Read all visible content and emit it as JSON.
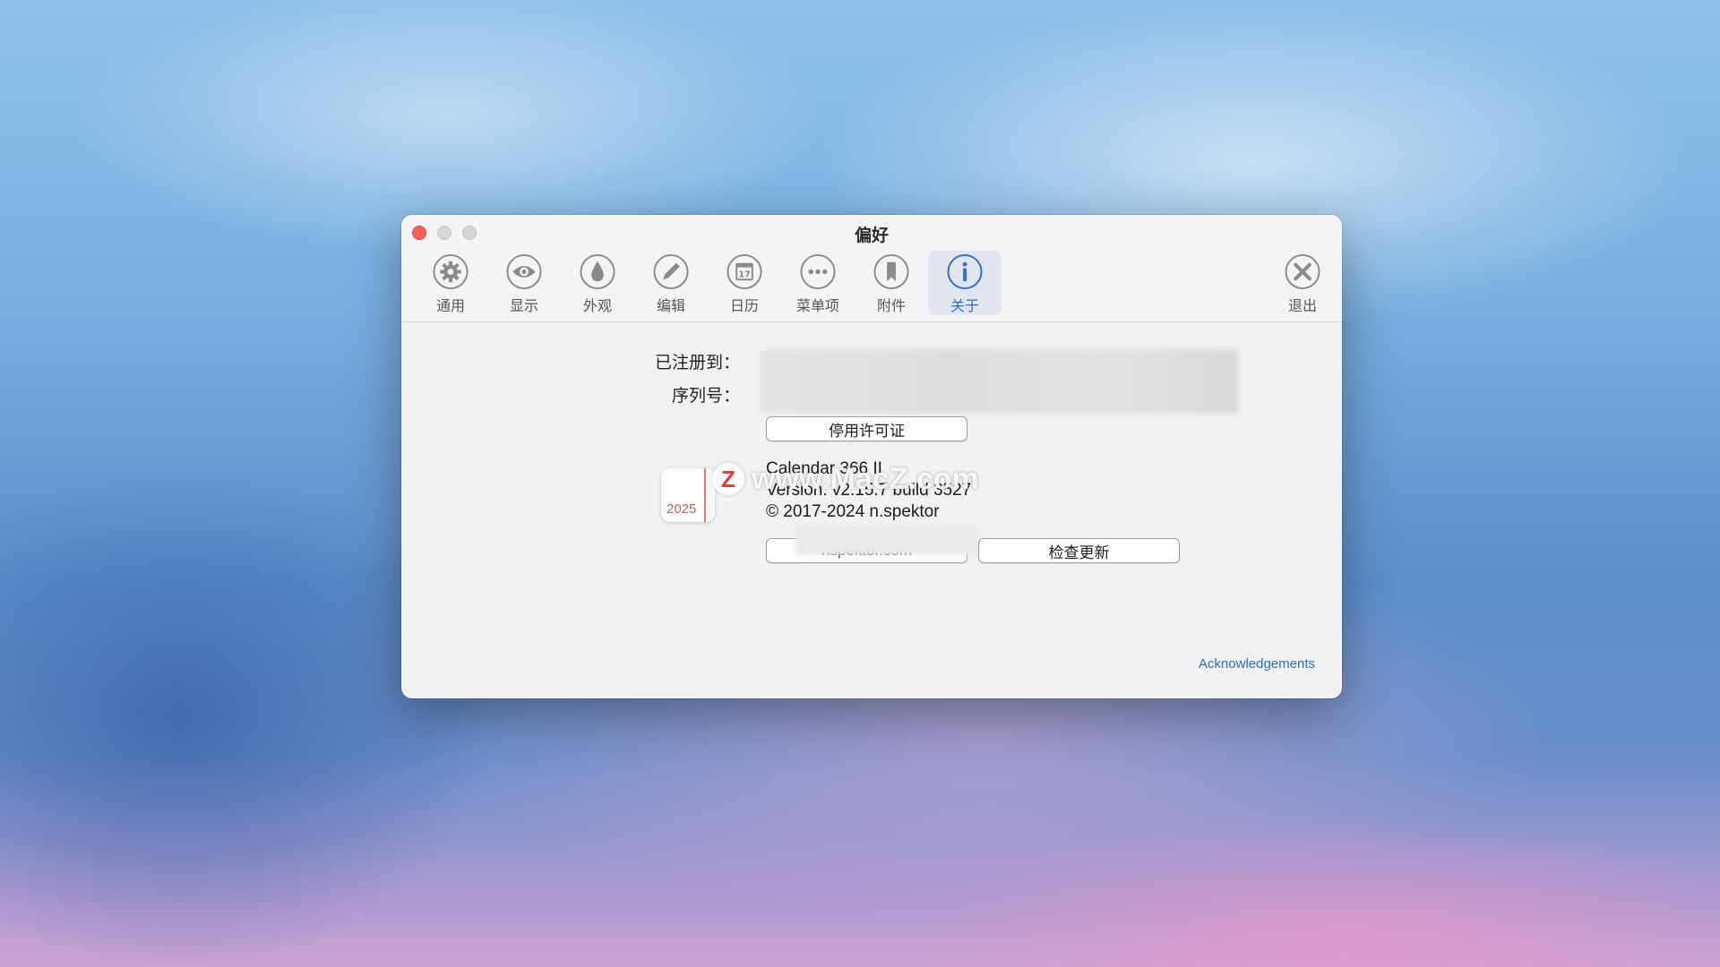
{
  "window": {
    "title": "偏好"
  },
  "toolbar": {
    "items": [
      {
        "label": "通用",
        "icon": "gear-icon"
      },
      {
        "label": "显示",
        "icon": "eye-icon"
      },
      {
        "label": "外观",
        "icon": "drop-icon"
      },
      {
        "label": "编辑",
        "icon": "pencil-icon"
      },
      {
        "label": "日历",
        "icon": "calendar-icon",
        "icon_text": "17"
      },
      {
        "label": "菜单项",
        "icon": "ellipsis-icon"
      },
      {
        "label": "附件",
        "icon": "bookmark-icon"
      },
      {
        "label": "关于",
        "icon": "info-icon",
        "active": true
      }
    ],
    "quit": {
      "label": "退出",
      "icon": "close-circle-icon"
    }
  },
  "about": {
    "registered_to_label": "已注册到：",
    "serial_label": "序列号：",
    "deactivate_button": "停用许可证",
    "app_icon_year": "2025",
    "app_name": "Calendar 366 II",
    "version": "Version: v2.15.7 build 3527",
    "copyright": "© 2017-2024 n.spektor",
    "website_button": "nspektor.com",
    "check_update_button": "检查更新",
    "acknowledgements_link": "Acknowledgements"
  },
  "watermark": {
    "badge": "Z",
    "text": "www.MacZ.com"
  },
  "colors": {
    "accent": "#2f6ed8",
    "close": "#fe5f57",
    "link": "#2a6fc0"
  }
}
